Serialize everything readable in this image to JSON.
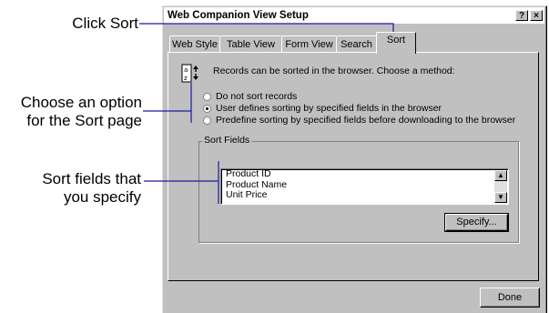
{
  "callouts": {
    "click_sort": "Click Sort",
    "choose_option_line1": "Choose an option",
    "choose_option_line2": "for the Sort page",
    "sort_fields_line1": "Sort fields that",
    "sort_fields_line2": "you specify"
  },
  "dialog": {
    "title": "Web Companion View Setup",
    "help_button": "?",
    "close_button": "×",
    "tabs": [
      "Web Style",
      "Table View",
      "Form View",
      "Search",
      "Sort"
    ],
    "active_tab": "Sort",
    "intro_text": "Records can be sorted in the browser.  Choose a method:",
    "radio_options": [
      {
        "label": "Do not sort records",
        "checked": false
      },
      {
        "label": "User defines sorting by specified fields in the browser",
        "checked": true
      },
      {
        "label": "Predefine sorting by specified fields before downloading to the browser",
        "checked": false
      }
    ],
    "sort_fields_group_label": "Sort Fields",
    "sort_fields": [
      "Product ID",
      "Product Name",
      "Unit Price"
    ],
    "specify_button": "Specify...",
    "done_button": "Done"
  },
  "colors": {
    "dialog_face": "#c0c0c0",
    "callout_line": "#1a1aa0"
  },
  "icons": [
    "sort-order-icon",
    "scroll-up-arrow-icon",
    "scroll-down-arrow-icon"
  ]
}
